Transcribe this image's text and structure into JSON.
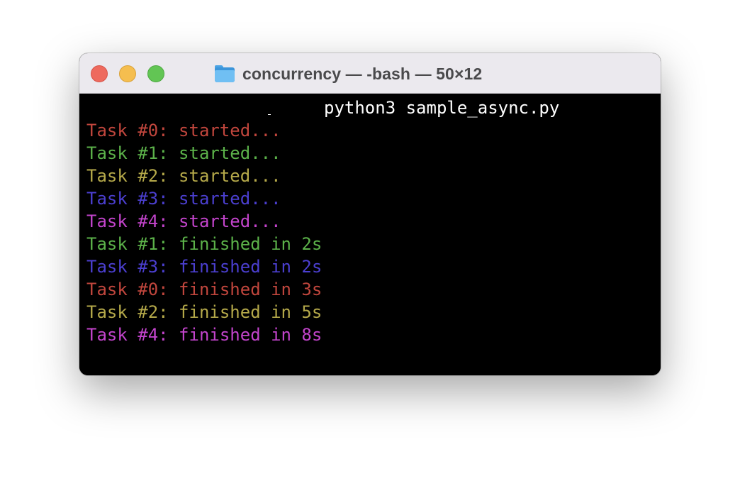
{
  "window": {
    "title": "concurrency — -bash — 50×12",
    "title_icon": "folder-icon"
  },
  "terminal": {
    "command": "python3 sample_async.py",
    "lines": [
      {
        "text": "Task #0: started...",
        "color": "#c1463d"
      },
      {
        "text": "Task #1: started...",
        "color": "#5cb24a"
      },
      {
        "text": "Task #2: started...",
        "color": "#b5a94a"
      },
      {
        "text": "Task #3: started...",
        "color": "#4b3fd0"
      },
      {
        "text": "Task #4: started...",
        "color": "#c344cc"
      },
      {
        "text": "Task #1: finished in 2s",
        "color": "#5cb24a"
      },
      {
        "text": "Task #3: finished in 2s",
        "color": "#4b3fd0"
      },
      {
        "text": "Task #0: finished in 3s",
        "color": "#c1463d"
      },
      {
        "text": "Task #2: finished in 5s",
        "color": "#b5a94a"
      },
      {
        "text": "Task #4: finished in 8s",
        "color": "#c344cc"
      }
    ]
  },
  "colors": {
    "titlebar_bg": "#ebe9ee",
    "terminal_bg": "#000000",
    "command_text": "#ffffff",
    "close": "#ee6a5e",
    "minimize": "#f5be4f",
    "zoom": "#62c554"
  }
}
